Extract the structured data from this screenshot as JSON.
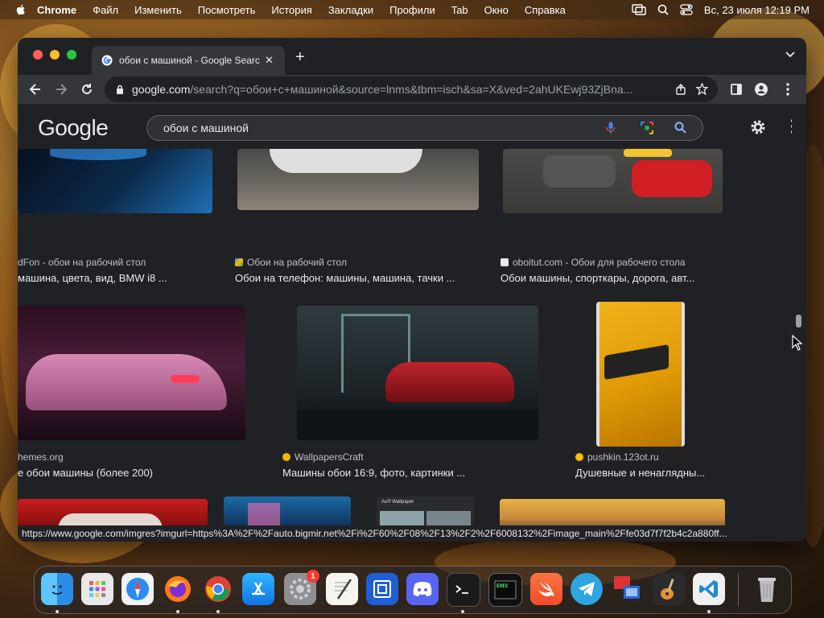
{
  "menubar": {
    "app_name": "Chrome",
    "items": [
      "Файл",
      "Изменить",
      "Посмотреть",
      "История",
      "Закладки",
      "Профили",
      "Tab",
      "Окно",
      "Справка"
    ],
    "datetime": "Вс, 23 июля  12:19 PM"
  },
  "browser": {
    "tab_title": "обои с машиной - Google Search",
    "url_host": "google.com",
    "url_path": "/search?q=обои+с+машиной&source=lnms&tbm=isch&sa=X&ved=2ahUKEwj93ZjBna...",
    "status_url": "https://www.google.com/imgres?imgurl=https%3A%2F%2Fauto.bigmir.net%2Fi%2F60%2F08%2F13%2F2%2F6008132%2Fimage_main%2Ffe03d7f7f2b4c2a880ff..."
  },
  "google": {
    "logo": "Google",
    "query": "обои с машиной"
  },
  "results": [
    {
      "source": "dFon - обои на рабочий стол",
      "caption": "машина, цвета, вид, BMW i8 ..."
    },
    {
      "source": "Обои на рабочий стол",
      "caption": "Обои на телефон: машины, машина, тачки ..."
    },
    {
      "source": "oboitut.com - Обои для рабочего стола",
      "caption": "Обои машины, спорткары, дорога, авт..."
    },
    {
      "source": "hemes.org",
      "caption": "е обои машины (более 200)"
    },
    {
      "source": "WallpapersCraft",
      "caption": "Машины обои 16:9, фото, картинки ..."
    },
    {
      "source": "pushkin.123ot.ru",
      "caption": "Душевные и ненаглядны..."
    }
  ],
  "dock": {
    "settings_badge": "1",
    "app_icons": [
      "finder-icon",
      "launchpad-icon",
      "safari-icon",
      "firefox-icon",
      "chrome-icon",
      "app-store-icon",
      "system-settings-icon",
      "textedit-icon",
      "screenshot-icon",
      "discord-icon",
      "terminal-icon",
      "console-icon",
      "swift-icon",
      "telegram-icon",
      "remote-desktop-icon",
      "garageband-icon",
      "vscode-icon",
      "trash-icon"
    ]
  },
  "colors": {
    "window_bg": "#202124",
    "toolbar_bg": "#35363a",
    "text": "#e8eaed",
    "muted": "#9aa0a6"
  }
}
